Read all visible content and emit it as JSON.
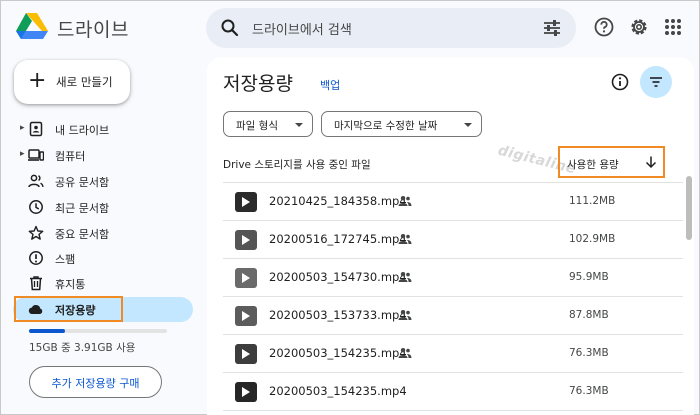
{
  "header": {
    "brand": "드라이브",
    "search_placeholder": "드라이브에서 검색",
    "icons": [
      "drive-logo",
      "search-icon",
      "tune-icon",
      "help-icon",
      "settings-icon",
      "apps-icon"
    ]
  },
  "sidebar": {
    "new_label": "새로 만들기",
    "items": [
      {
        "label": "내 드라이브",
        "icon": "my-drive-icon",
        "expandable": true
      },
      {
        "label": "컴퓨터",
        "icon": "computer-icon",
        "expandable": true
      },
      {
        "label": "공유 문서함",
        "icon": "shared-icon",
        "expandable": false
      },
      {
        "label": "최근 문서함",
        "icon": "recent-icon",
        "expandable": false
      },
      {
        "label": "중요 문서함",
        "icon": "star-icon",
        "expandable": false
      },
      {
        "label": "스팸",
        "icon": "spam-icon",
        "expandable": false
      },
      {
        "label": "휴지통",
        "icon": "trash-icon",
        "expandable": false
      },
      {
        "label": "저장용량",
        "icon": "cloud-icon",
        "expandable": false,
        "active": true
      }
    ],
    "usage_text": "15GB 중 3.91GB 사용",
    "usage_fraction": 0.26,
    "buy_label": "추가 저장용량 구매"
  },
  "main": {
    "title": "저장용량",
    "backup_link": "백업",
    "filters": [
      "파일 형식",
      "마지막으로 수정한 날짜"
    ],
    "list_header": "Drive 스토리지를 사용 중인 파일",
    "sort_label": "사용한 용량",
    "watermark": "digitaline",
    "files": [
      {
        "name": "20210425_184358.mp4",
        "size": "111.2MB",
        "shared": true
      },
      {
        "name": "20200516_172745.mp4",
        "size": "102.9MB",
        "shared": true
      },
      {
        "name": "20200503_154730.mp4",
        "size": "95.9MB",
        "shared": true
      },
      {
        "name": "20200503_153733.mp4",
        "size": "87.8MB",
        "shared": true
      },
      {
        "name": "20200503_154235.mp4",
        "size": "76.3MB",
        "shared": true
      },
      {
        "name": "20200503_154235.mp4",
        "size": "76.3MB",
        "shared": false
      }
    ]
  },
  "colors": {
    "accent": "#0b57d0",
    "active_bg": "#c2e7ff",
    "highlight_box": "#f08a24",
    "search_bg": "#e9eef6"
  }
}
